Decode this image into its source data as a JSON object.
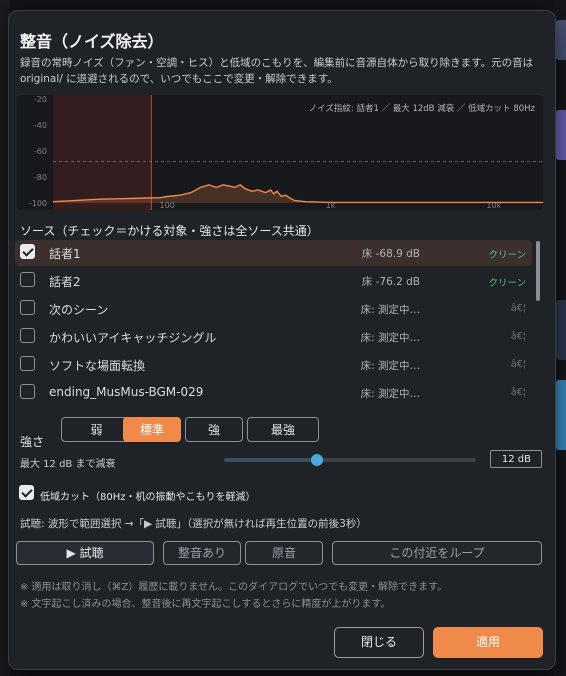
{
  "dialog": {
    "title": "整音（ノイズ除去）",
    "description": "録音の常時ノイズ（ファン・空調・ヒス）と低域のこもりを、編集前に音源自体から取り除きます。元の音は original/ に退避されるので、いつでもここで変更・解除できます。"
  },
  "spectrum": {
    "info": "ノイズ指紋: 話者1 ／ 最大 12dB 減衰 ／ 低域カット 80Hz",
    "y_ticks": [
      "-20",
      "-40",
      "-60",
      "-80",
      "-100"
    ],
    "x_ticks": [
      "100",
      "1k",
      "10k"
    ],
    "colors": {
      "curve": "#f08a4b",
      "cut_region": "#3a1f1e",
      "cut_line": "#c2453c",
      "threshold": "#9aa0a8"
    }
  },
  "chart_data": {
    "type": "area",
    "xscale": "log",
    "x_hz": [
      20,
      40,
      60,
      80,
      90,
      100,
      120,
      140,
      150,
      160,
      180,
      200,
      220,
      240,
      260,
      280,
      300,
      330,
      360,
      400,
      430,
      450,
      470,
      500,
      530,
      560,
      600,
      700,
      1000,
      2000,
      5000,
      10000,
      20000
    ],
    "y_db": [
      -99,
      -97,
      -96.5,
      -96,
      -96,
      -95,
      -94,
      -92,
      -90,
      -88,
      -86,
      -88,
      -86,
      -87,
      -88,
      -86,
      -89,
      -91,
      -90,
      -92,
      -90,
      -93,
      -91,
      -95,
      -94,
      -96,
      -98,
      -99,
      -99.5,
      -99.5,
      -99.5,
      -99.5,
      -99.5
    ],
    "ylim": [
      -100,
      -20
    ],
    "xlim": [
      20,
      20000
    ],
    "threshold_db": -68,
    "lowcut_hz": 80
  },
  "sources": {
    "heading": "ソース（チェック＝かける対象・強さは全ソース共通）",
    "items": [
      {
        "name": "話者1",
        "floor": "床 -68.9 dB",
        "status": "クリーン",
        "checked": true,
        "selected": true,
        "status_kind": "clean"
      },
      {
        "name": "話者2",
        "floor": "床 -76.2 dB",
        "status": "クリーン",
        "checked": false,
        "selected": false,
        "status_kind": "clean"
      },
      {
        "name": "次のシーン",
        "floor": "床: 測定中…",
        "status": "â€¦",
        "checked": false,
        "selected": false,
        "status_kind": "dim"
      },
      {
        "name": "かわいいアイキャッチジングル",
        "floor": "床: 測定中…",
        "status": "â€¦",
        "checked": false,
        "selected": false,
        "status_kind": "dim"
      },
      {
        "name": "ソフトな場面転換",
        "floor": "床: 測定中…",
        "status": "â€¦",
        "checked": false,
        "selected": false,
        "status_kind": "dim"
      },
      {
        "name": "ending_MusMus-BGM-029",
        "floor": "床: 測定中…",
        "status": "â€¦",
        "checked": false,
        "selected": false,
        "status_kind": "dim"
      }
    ]
  },
  "strength": {
    "label": "強さ",
    "options": [
      "弱",
      "標準",
      "強",
      "最強"
    ],
    "selected": "標準"
  },
  "attenuation": {
    "label": "最大 12 dB まで減衰",
    "value_text": "12 dB",
    "slider_fraction": 0.37
  },
  "lowcut": {
    "checked": true,
    "label": "低域カット（80Hz・机の振動やこもりを軽減）"
  },
  "preview": {
    "hint": "試聴: 波形で範囲選択 →「▶ 試聴」（選択が無ければ再生位置の前後3秒）",
    "play_label": "▶ 試聴",
    "processed_label": "整音あり",
    "original_label": "原音",
    "loop_label": "この付近をループ"
  },
  "notes": [
    "※ 適用は取り消し（⌘Z）履歴に載りません。このダイアログでいつでも変更・解除できます。",
    "※ 文字起こし済みの場合、整音後に再文字起こしするとさらに精度が上がります。"
  ],
  "footer": {
    "close_label": "閉じる",
    "apply_label": "適用"
  },
  "accent_color": "#f08a4b"
}
